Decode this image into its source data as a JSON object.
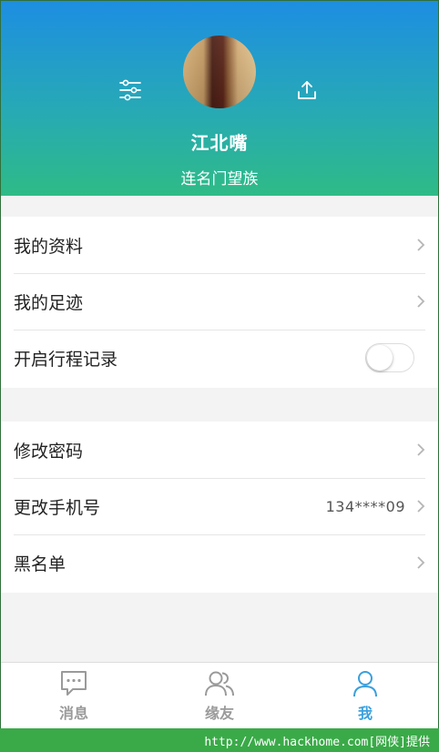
{
  "profile": {
    "name": "江北嘴",
    "subtitle": "连名门望族",
    "avatar_icon": "user-avatar-photo",
    "filter_icon": "sliders-icon",
    "share_icon": "share-upload-icon"
  },
  "settings_group_1": [
    {
      "label": "我的资料",
      "type": "link"
    },
    {
      "label": "我的足迹",
      "type": "link"
    },
    {
      "label": "开启行程记录",
      "type": "toggle",
      "enabled": false
    }
  ],
  "settings_group_2": [
    {
      "label": "修改密码",
      "type": "link"
    },
    {
      "label": "更改手机号",
      "type": "link",
      "value": "134****09"
    },
    {
      "label": "黑名单",
      "type": "link"
    }
  ],
  "tabbar": {
    "tabs": [
      {
        "label": "消息",
        "icon": "chat-bubble-icon",
        "active": false
      },
      {
        "label": "缘友",
        "icon": "friends-icon",
        "active": false
      },
      {
        "label": "我",
        "icon": "person-icon",
        "active": true
      }
    ]
  },
  "watermark": {
    "text": "http://www.hackhome.com[网侠]提供"
  },
  "colors": {
    "header_top": "#1d8ee2",
    "header_bottom": "#2fbb86",
    "active_tab": "#3aa0dd",
    "inactive_tab": "#9a9a9a",
    "watermark_bg": "#3aaa48"
  }
}
